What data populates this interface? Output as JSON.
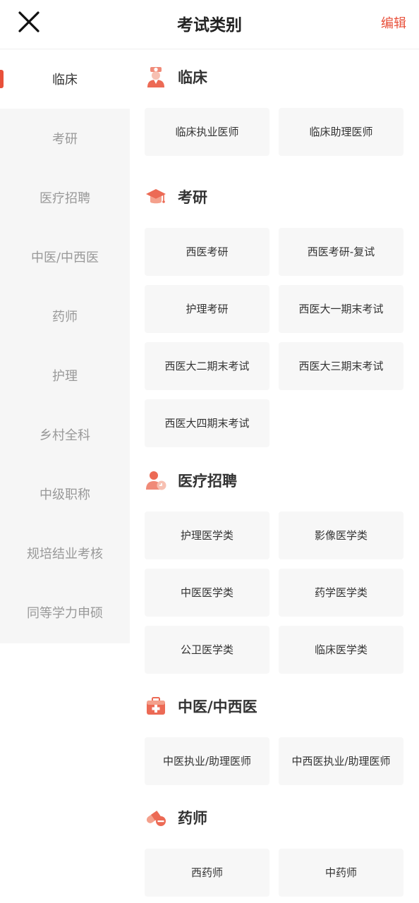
{
  "header": {
    "title": "考试类别",
    "edit_label": "编辑",
    "close_icon": "close-icon"
  },
  "sidebar": {
    "active_index": 0,
    "items": [
      {
        "label": "临床"
      },
      {
        "label": "考研"
      },
      {
        "label": "医疗招聘"
      },
      {
        "label": "中医/中西医"
      },
      {
        "label": "药师"
      },
      {
        "label": "护理"
      },
      {
        "label": "乡村全科"
      },
      {
        "label": "中级职称"
      },
      {
        "label": "规培结业考核"
      },
      {
        "label": "同等学力申硕"
      }
    ]
  },
  "sections": [
    {
      "title": "临床",
      "icon": "doctor-icon",
      "items": [
        "临床执业医师",
        "临床助理医师"
      ]
    },
    {
      "title": "考研",
      "icon": "graduation-cap-icon",
      "items": [
        "西医考研",
        "西医考研-复试",
        "护理考研",
        "西医大一期末考试",
        "西医大二期末考试",
        "西医大三期末考试",
        "西医大四期末考试"
      ]
    },
    {
      "title": "医疗招聘",
      "icon": "recruit-user-icon",
      "items": [
        "护理医学类",
        "影像医学类",
        "中医医学类",
        "药学医学类",
        "公卫医学类",
        "临床医学类"
      ]
    },
    {
      "title": "中医/中西医",
      "icon": "medical-kit-icon",
      "items": [
        "中医执业/助理医师",
        "中西医执业/助理医师"
      ]
    },
    {
      "title": "药师",
      "icon": "pill-icon",
      "items": [
        "西药师",
        "中药师"
      ]
    }
  ],
  "colors": {
    "accent": "#e8503a",
    "sidebar_bg": "#f6f6f6",
    "card_bg": "#f7f7f7"
  }
}
